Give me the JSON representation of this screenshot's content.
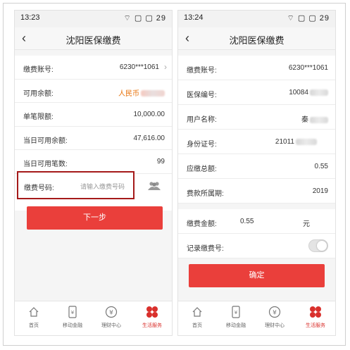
{
  "screen1": {
    "status": {
      "time": "13:23",
      "icons": "⌔ ▢ ▢ 29"
    },
    "title": "沈阳医保缴费",
    "rows": [
      {
        "label": "缴费账号:",
        "value": "6230***1061"
      },
      {
        "label": "可用余额:",
        "value": "人民币"
      },
      {
        "label": "单笔限额:",
        "value": "10,000.00"
      },
      {
        "label": "当日可用余额:",
        "value": "47,616.00"
      },
      {
        "label": "当日可用笔数:",
        "value": "99"
      }
    ],
    "input": {
      "label": "缴费号码:",
      "placeholder": "请输入缴费号码"
    },
    "next_button": "下一步",
    "tabs": [
      {
        "label": "首页"
      },
      {
        "label": "移动金融"
      },
      {
        "label": "理财中心"
      },
      {
        "label": "生活服务"
      }
    ]
  },
  "screen2": {
    "status": {
      "time": "13:24",
      "icons": "⌔ ▢ ▢ 29"
    },
    "title": "沈阳医保缴费",
    "rows": [
      {
        "label": "缴费账号:",
        "value": "6230***1061"
      },
      {
        "label": "医保编号:",
        "value": "10084"
      },
      {
        "label": "用户名称:",
        "value": "秦"
      },
      {
        "label": "身份证号:",
        "value": "21011"
      },
      {
        "label": "应缴总额:",
        "value": "0.55"
      },
      {
        "label": "费款所属期:",
        "value": "2019"
      }
    ],
    "amount": {
      "label": "缴费金额:",
      "value": "0.55",
      "unit": "元"
    },
    "record": {
      "label": "记录缴费号:",
      "toggle_on": false
    },
    "confirm_button": "确定",
    "tabs": [
      {
        "label": "首页"
      },
      {
        "label": "移动金融"
      },
      {
        "label": "理财中心"
      },
      {
        "label": "生活服务"
      }
    ]
  },
  "colors": {
    "accent": "#ea3f3b",
    "highlight_border": "#a51a1a",
    "orange_value": "#e8730c"
  }
}
